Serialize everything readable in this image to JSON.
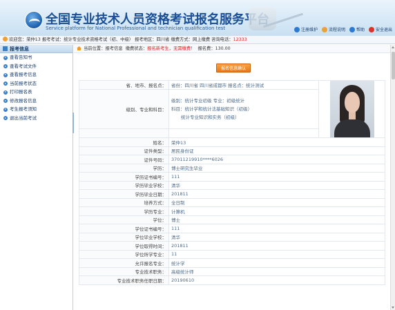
{
  "header": {
    "title_cn": "全国专业技术人员资格考试报名服务平台",
    "title_en": "Service platform for National Professional and technician qualification test",
    "links": [
      {
        "label": "注册维护",
        "icon": "user-edit-icon",
        "color": "#2c7bd0"
      },
      {
        "label": "流程说明",
        "icon": "flow-icon",
        "color": "#e8a33a"
      },
      {
        "label": "帮助",
        "icon": "help-icon",
        "color": "#2c7bd0"
      },
      {
        "label": "安全退出",
        "icon": "logout-icon",
        "color": "#d9332b"
      }
    ]
  },
  "infobar": {
    "welcome_label": "欢迎您：",
    "user": "荣仲13",
    "exam_label": "报考考试：",
    "exam": "统计专业技术资格考试（初、中级）",
    "region_label": "报考地区：",
    "region": "四川省",
    "pay_label": "缴费方式：",
    "pay": "网上缴费",
    "phone_label": "咨询电话：",
    "phone": "12333"
  },
  "sidebar": {
    "header": "报考信息",
    "items": [
      {
        "label": "查看告知书"
      },
      {
        "label": "查看考试文件"
      },
      {
        "label": "查看报考信息"
      },
      {
        "label": "当前报考状态"
      },
      {
        "label": "打印报名表"
      },
      {
        "label": "修改报名信息"
      },
      {
        "label": "考生报考须知"
      },
      {
        "label": "退出当前考试"
      }
    ]
  },
  "main": {
    "crumb_label": "当前位置：",
    "crumb_path": "报考信息",
    "fee_status_label": "缴费状态：",
    "fee_status": "报名新考生，无需缴费！",
    "fee_label": "报名费：",
    "fee": "130.00",
    "confirm_button": "报名信息确认",
    "region_row": {
      "key": "省、地市、报名点：",
      "value": "省份：四川省   四川省成都市   报名点：统计测试"
    },
    "level_row": {
      "key": "级别、专业和科目：",
      "lines": [
        "级别：统计专业初级   专业：初级统计",
        "科目：统计学和统计法基础知识（初级）",
        "统计专业知识和实务（初级）"
      ]
    },
    "rows": [
      {
        "key": "姓名：",
        "value": "荣仲13"
      },
      {
        "key": "证件类型：",
        "value": "居民身份证"
      },
      {
        "key": "证件号码：",
        "value": "37011219910****6026"
      },
      {
        "key": "学历：",
        "value": "博士研究生毕业"
      },
      {
        "key": "学历证书编号：",
        "value": "111"
      },
      {
        "key": "学历毕业学校：",
        "value": "清华"
      },
      {
        "key": "学历毕业日期：",
        "value": "201811"
      },
      {
        "key": "培养方式：",
        "value": "全日制"
      },
      {
        "key": "学历专业：",
        "value": "计算机"
      },
      {
        "key": "学位：",
        "value": "博士"
      },
      {
        "key": "学位证书编号：",
        "value": "111"
      },
      {
        "key": "学位毕业学校：",
        "value": "清华"
      },
      {
        "key": "学位取得时间：",
        "value": "201811"
      },
      {
        "key": "学位所学专业：",
        "value": "11"
      },
      {
        "key": "允许报名专业：",
        "value": "统计学"
      },
      {
        "key": "专业技术职务：",
        "value": "高级统计师"
      },
      {
        "key": "专业技术职务任职日期：",
        "value": "20190610"
      }
    ]
  }
}
